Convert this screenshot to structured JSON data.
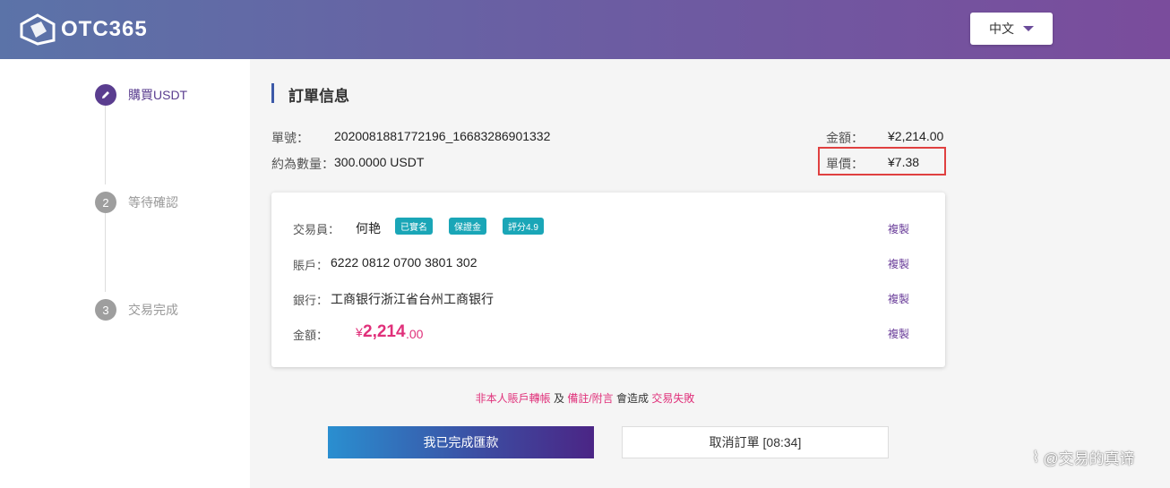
{
  "header": {
    "logo_text": "OTC365",
    "language": "中文"
  },
  "steps": [
    {
      "num": "",
      "label": "購買USDT",
      "active": true
    },
    {
      "num": "2",
      "label": "等待確認",
      "active": false
    },
    {
      "num": "3",
      "label": "交易完成",
      "active": false
    }
  ],
  "order": {
    "title": "訂單信息",
    "order_no_label": "單號：",
    "order_no": "2020081881772196_16683286901332",
    "quantity_label": "約為數量：",
    "quantity": "300.0000 USDT",
    "amount_label": "金額：",
    "amount": "¥2,214.00",
    "price_label": "單價：",
    "price": "¥7.38"
  },
  "card": {
    "trader_label": "交易員：",
    "trader_name": "何艳",
    "tags": [
      "已實名",
      "保證金",
      "評分4.9"
    ],
    "account_label": "賬戶：",
    "account": "6222 0812 0700 3801 302",
    "bank_label": "銀行：",
    "bank": "工商银行浙江省台州工商银行",
    "amount_label": "金額：",
    "amount_currency": "¥",
    "amount_int": "2,214",
    "amount_dec": ".00",
    "copy_label": "複製"
  },
  "warning": {
    "part1": "非本人賬戶轉帳",
    "part2": " 及 ",
    "part3": "備註/附言",
    "part4": " 會造成 ",
    "part5": "交易失敗"
  },
  "buttons": {
    "confirm": "我已完成匯款",
    "cancel": "取消訂單 [08:34]"
  },
  "watermark": "@交易的真谛",
  "colors": {
    "accent": "#5a3d8f",
    "pink": "#e0307a",
    "tag": "#1aa6b7"
  }
}
